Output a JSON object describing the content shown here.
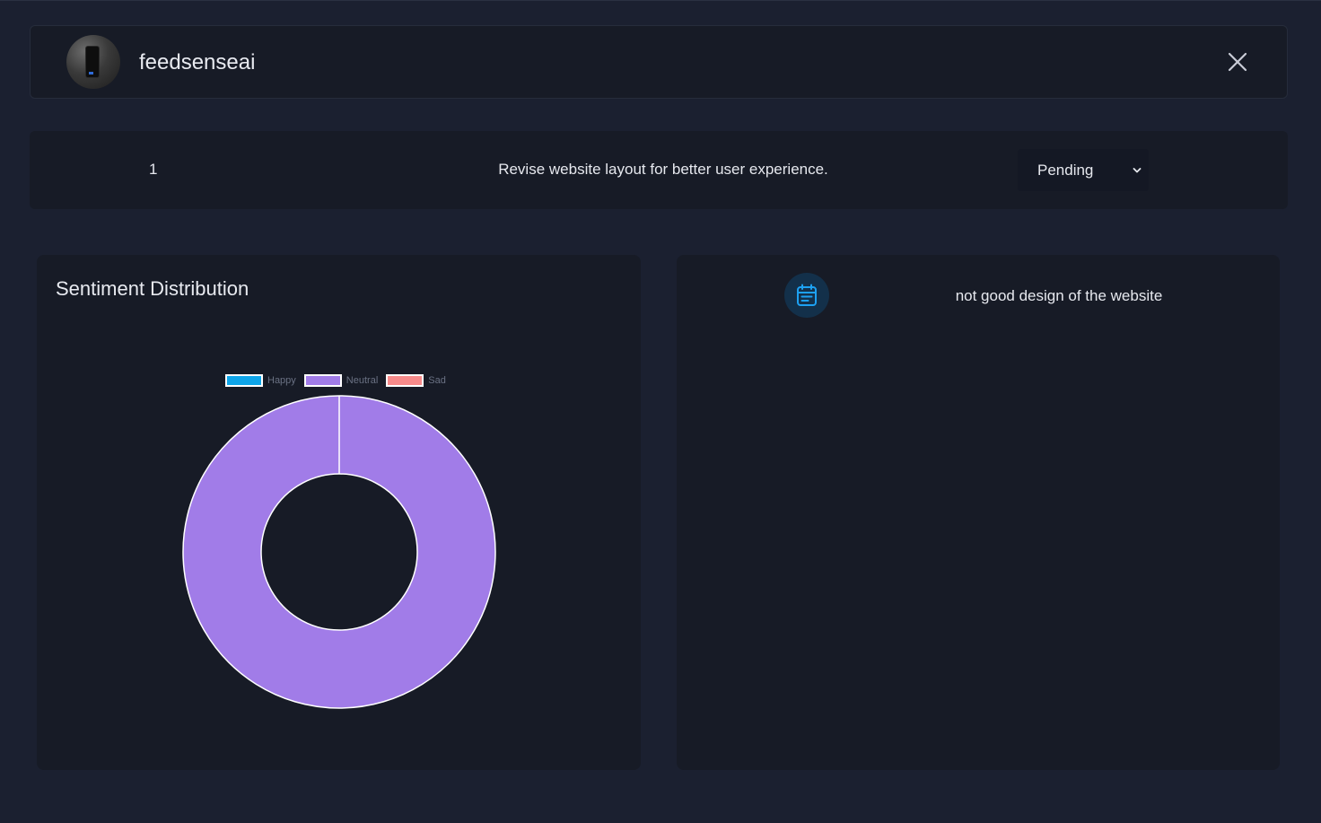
{
  "header": {
    "app_name": "feedsenseai"
  },
  "task": {
    "number": "1",
    "description": "Revise website layout for better user experience.",
    "status_selected": "Pending"
  },
  "sentiment_panel": {
    "title": "Sentiment Distribution"
  },
  "chart_data": {
    "type": "pie",
    "categories": [
      "Happy",
      "Neutral",
      "Sad"
    ],
    "values": [
      0,
      1,
      0
    ],
    "colors": [
      "#0ea5e9",
      "#a17ce8",
      "#f78a8a"
    ],
    "legend_position": "top",
    "title": ""
  },
  "feedback_panel": {
    "icon": "calendar-note-icon",
    "text": "not good design of the website"
  },
  "colors": {
    "background": "#1b2030",
    "card": "#171b26",
    "accent": "#1da1f2"
  }
}
